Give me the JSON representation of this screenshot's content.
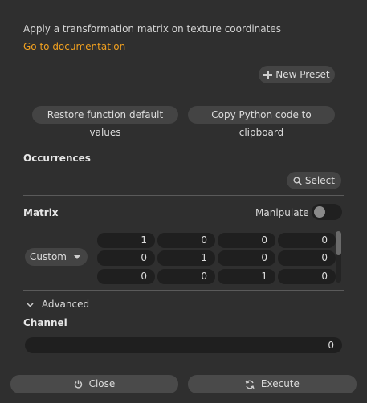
{
  "description": "Apply a transformation matrix on texture coordinates",
  "doc_link": "Go to documentation",
  "buttons": {
    "new_preset": "New Preset",
    "restore_defaults": "Restore function default values",
    "copy_python": "Copy Python code to clipboard",
    "select": "Select",
    "close": "Close",
    "execute": "Execute"
  },
  "occurrences": {
    "title": "Occurrences"
  },
  "matrix": {
    "title": "Matrix",
    "manipulate_label": "Manipulate",
    "manipulate_on": false,
    "mode": "Custom",
    "rows": [
      [
        "1",
        "0",
        "0",
        "0"
      ],
      [
        "0",
        "1",
        "0",
        "0"
      ],
      [
        "0",
        "0",
        "1",
        "0"
      ]
    ]
  },
  "advanced": {
    "label": "Advanced",
    "channel_title": "Channel",
    "channel_value": "0"
  },
  "colors": {
    "link": "#f0a020",
    "background": "#2f2f2f"
  },
  "icons": {
    "new_preset": "plus-icon",
    "select": "search-icon",
    "close": "power-icon",
    "execute": "refresh-icon",
    "advanced": "chevron-down-icon",
    "mode": "caret-down-icon"
  }
}
